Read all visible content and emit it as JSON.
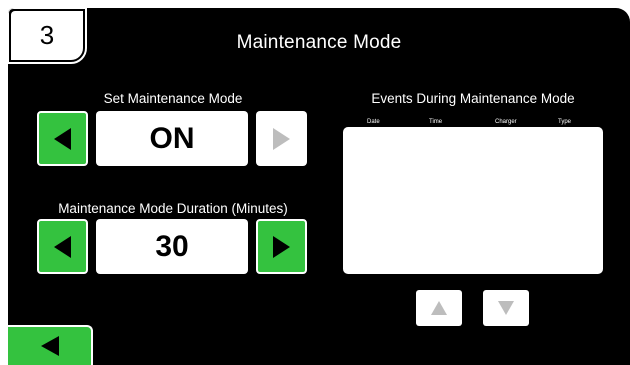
{
  "page_number": "3",
  "title": "Maintenance Mode",
  "set_mode": {
    "label": "Set Maintenance Mode",
    "value": "ON"
  },
  "duration": {
    "label": "Maintenance Mode Duration (Minutes)",
    "value": "30"
  },
  "events": {
    "label": "Events During Maintenance Mode",
    "columns": [
      "Date",
      "Time",
      "Charger",
      "Type"
    ],
    "rows": []
  },
  "colors": {
    "accent_green": "#34c23f",
    "background": "#000000",
    "panel": "#ffffff",
    "disabled": "#bdbdbd"
  },
  "icons": {
    "left": "left-arrow-icon",
    "right": "right-arrow-icon",
    "up": "up-arrow-icon",
    "down": "down-arrow-icon"
  }
}
